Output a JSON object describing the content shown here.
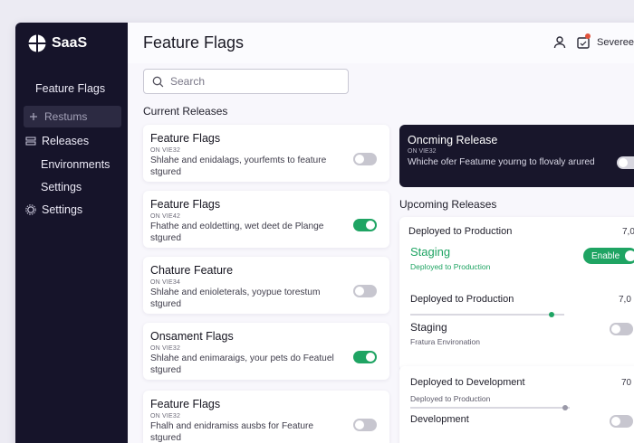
{
  "app": {
    "brand": "SaaS"
  },
  "sidebar": {
    "items": [
      {
        "label": "Feature Flags",
        "icon": "none"
      },
      {
        "label": "Restums",
        "icon": "plus-icon"
      },
      {
        "label": "Releases",
        "icon": "releases-icon"
      },
      {
        "label": "Environments",
        "icon": "none"
      },
      {
        "label": "Settings",
        "icon": "none"
      },
      {
        "label": "Settings",
        "icon": "gear-icon"
      }
    ]
  },
  "header": {
    "title": "Feature Flags",
    "username": "Severeed"
  },
  "search": {
    "placeholder": "Search"
  },
  "current": {
    "section_title": "Current Releases",
    "cards": [
      {
        "title": "Feature Flags",
        "version": "ON VIE32",
        "desc": "Shlahe and enidalags, yourfemts to feature stgured",
        "enabled": false
      },
      {
        "title": "Feature Flags",
        "version": "ON VIE42",
        "desc": "Fhathe and eoldetting, wet deet de Plange stgured",
        "enabled": true
      },
      {
        "title": "Chature Feature",
        "version": "ON VIE34",
        "desc": "Shlahe and enioleterals, yoypue torestum stgured",
        "enabled": false
      },
      {
        "title": "Onsament Flags",
        "version": "ON VIE32",
        "desc": "Shlahe and enimaraigs, your pets do Featuel stgured",
        "enabled": true
      },
      {
        "title": "Feature Flags",
        "version": "ON VIE32",
        "desc": "Fhalh and enidramiss ausbs for Feature stgured",
        "enabled": false
      }
    ]
  },
  "ongoing": {
    "title": "Oncming Release",
    "version": "ON VIE32",
    "desc": "Whiche ofer Featume yourng to flovaly arured",
    "enabled": false
  },
  "upcoming": {
    "section_title": "Upcoming Releases",
    "card1": {
      "row1_label": "Deployed to Production",
      "row1_num": "7,0",
      "env_label": "Staging",
      "env_sub": "Deployed to Production",
      "enable_label": "Enable",
      "row2_label": "Deployed to Production",
      "row2_num": "7,0",
      "row2_progress": 0.92,
      "env2_label": "Staging",
      "env2_sub": "Fratura Environation"
    },
    "card2": {
      "row1_label": "Deployed to Development",
      "row1_num": "70",
      "row1_sub": "Deployed to Production",
      "progress": 0.97,
      "env_label": "Development"
    }
  },
  "colors": {
    "accent_green": "#1fa463",
    "sidebar_bg": "#16142a",
    "toggle_off": "#c7c6cf"
  }
}
